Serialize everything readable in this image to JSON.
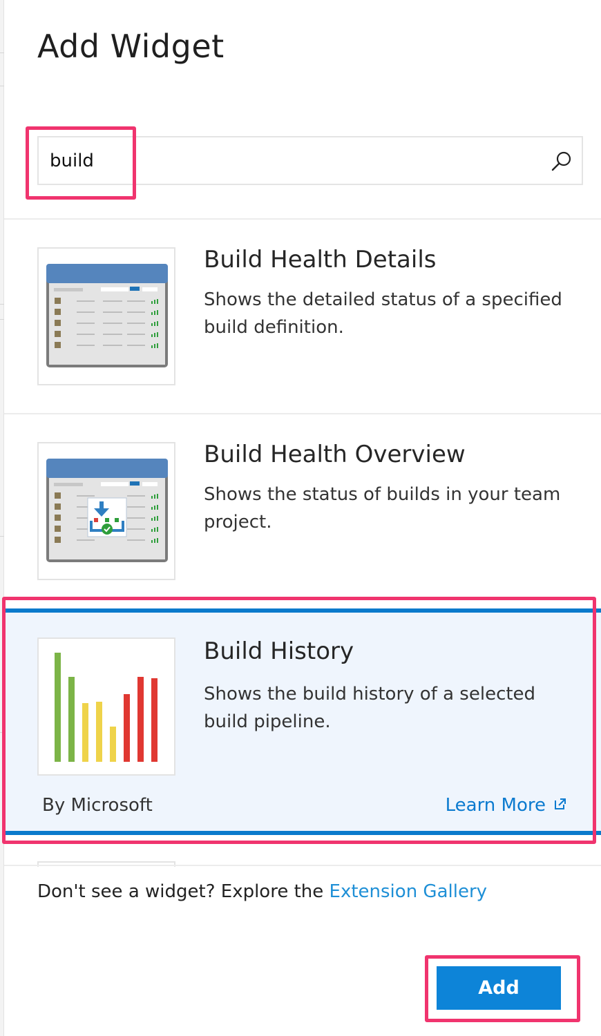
{
  "panel": {
    "title": "Add Widget"
  },
  "search": {
    "value": "build",
    "placeholder": ""
  },
  "widgets": [
    {
      "title": "Build Health Details",
      "description": "Shows the detailed status of a specified build definition."
    },
    {
      "title": "Build Health Overview",
      "description": "Shows the status of builds in your team project."
    },
    {
      "title": "Build History",
      "description": "Shows the build history of a selected build pipeline.",
      "publisher": "By Microsoft",
      "learn_more": "Learn More",
      "selected": true
    }
  ],
  "footer": {
    "prefix": "Don't see a widget? Explore the ",
    "link": "Extension Gallery"
  },
  "actions": {
    "add_label": "Add"
  },
  "colors": {
    "accent": "#0d84d8",
    "highlight": "#f0346e",
    "selection_border": "#0a7acc",
    "selection_bg": "#eff5fd",
    "link": "#1e8fd6"
  },
  "icons": {
    "search": "search-icon",
    "external": "external-link-icon"
  }
}
